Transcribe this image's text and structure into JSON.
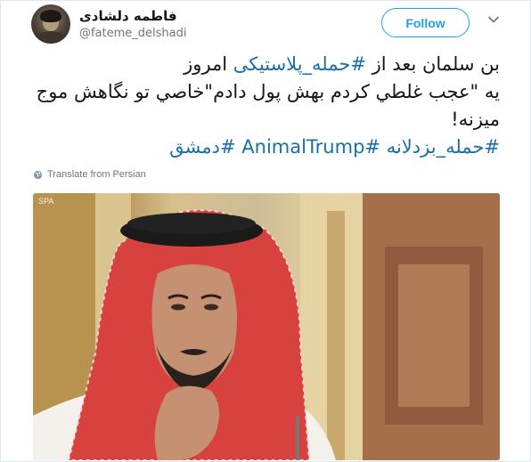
{
  "user": {
    "display_name": "فاطمه دلشادی",
    "handle": "@fateme_delshadi"
  },
  "actions": {
    "follow_label": "Follow"
  },
  "tweet": {
    "line1_prefix": "بن سلمان بعد از ",
    "line1_hashtag": "#حمله_پلاستیکی",
    "line1_suffix": " امروز",
    "line2": "يه \"عجب غلطي كردم بهش پول دادم\"خاصي تو نگاهش موج",
    "line3": "ميزنه!",
    "hashtags": [
      "#حمله_بزدلانه",
      "#AnimalTrump",
      "#دمشق"
    ]
  },
  "translate": {
    "label": "Translate from Persian"
  },
  "media": {
    "watermark": "SPA"
  },
  "colors": {
    "accent": "#1da1f2",
    "hashtag": "#1b6fa8",
    "muted": "#657786"
  }
}
